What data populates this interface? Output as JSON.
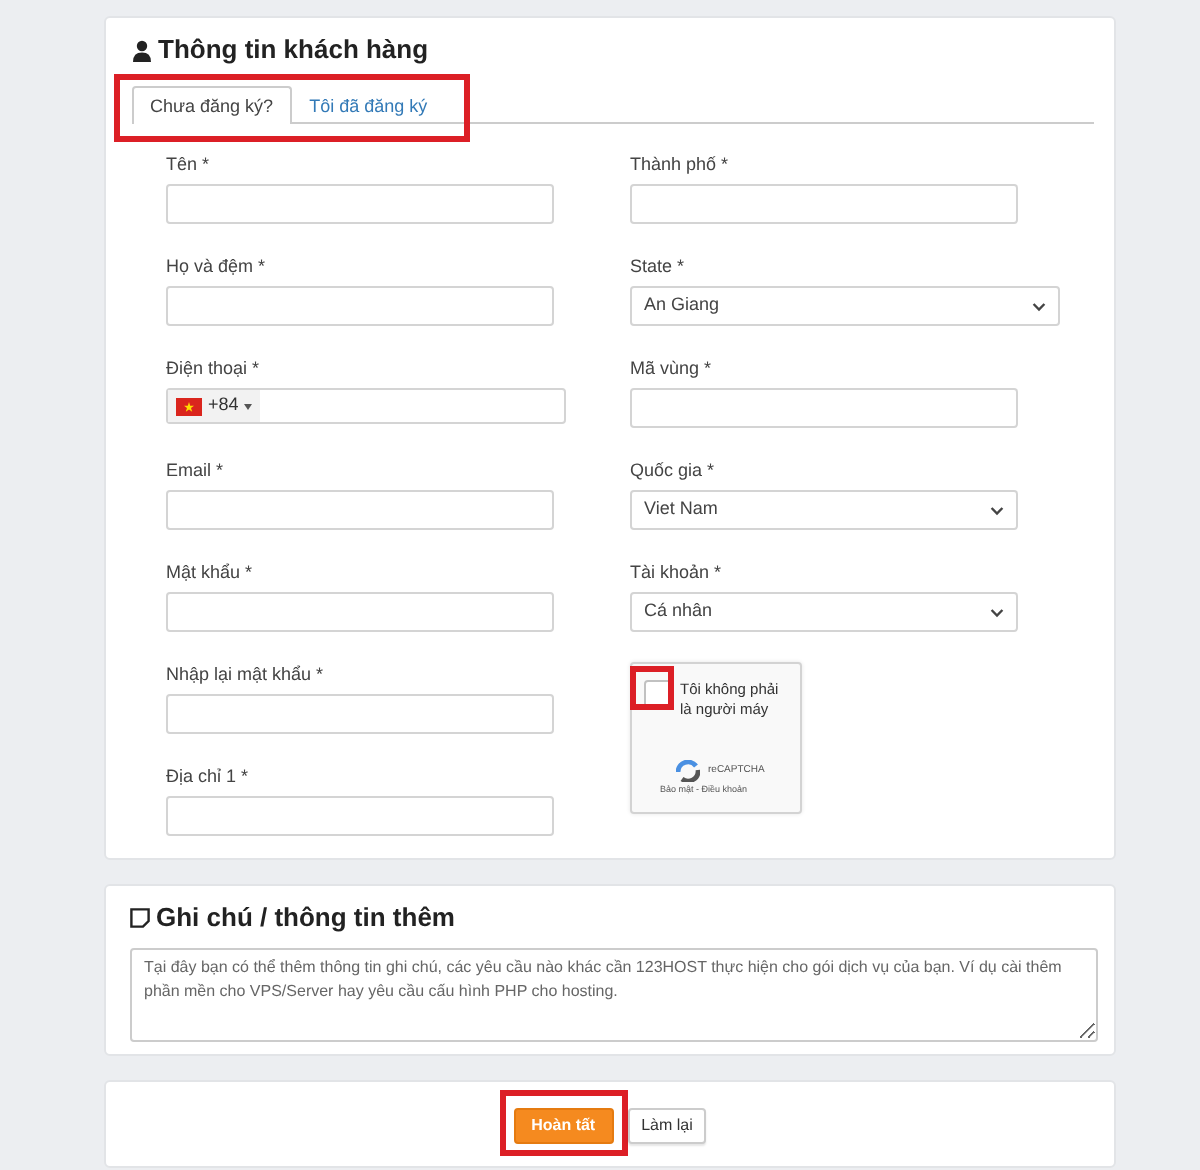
{
  "customer_info": {
    "title": "Thông tin khách hàng",
    "tabs": {
      "highlighted": true,
      "items": [
        {
          "label": "Chưa đăng ký?",
          "selected": true
        },
        {
          "label": "Tôi đã đăng ký",
          "selected": false
        }
      ]
    },
    "left_fields": [
      {
        "label": "Tên *",
        "kind": "text"
      },
      {
        "label": "Họ và đệm *",
        "kind": "text"
      },
      {
        "label": "Điện thoại *",
        "kind": "phone",
        "dial_code": "+84"
      },
      {
        "label": "Email *",
        "kind": "text"
      },
      {
        "label": "Mật khẩu *",
        "kind": "text"
      },
      {
        "label": "Nhập lại mật khẩu *",
        "kind": "text"
      },
      {
        "label": "Địa chỉ 1 *",
        "kind": "text"
      }
    ],
    "right_fields": [
      {
        "label": "Thành phố *",
        "kind": "text"
      },
      {
        "label": "State *",
        "kind": "select",
        "value": "An Giang",
        "wide": true
      },
      {
        "label": "Mã vùng *",
        "kind": "text"
      },
      {
        "label": "Quốc gia *",
        "kind": "select",
        "value": "Viet Nam",
        "wide": false
      },
      {
        "label": "Tài khoản *",
        "kind": "select",
        "value": "Cá nhân",
        "wide": false
      },
      {
        "kind": "captcha",
        "text": "Tôi không phải là người máy",
        "checked": false,
        "highlighted": true,
        "brand": "reCAPTCHA",
        "links": "Bảo mật - Điều khoản"
      }
    ]
  },
  "notes": {
    "title": "Ghi chú / thông tin thêm",
    "placeholder": "Tại đây bạn có thể thêm thông tin ghi chú, các yêu cầu nào khác cần 123HOST thực hiện cho gói dịch vụ của bạn. Ví dụ cài thêm phần mền cho VPS/Server hay yêu cầu cấu hình PHP cho hosting."
  },
  "buttons": [
    {
      "label": "Hoàn tất",
      "kind": "primary",
      "highlighted": true
    },
    {
      "label": "Làm lại",
      "kind": "secondary",
      "highlighted": false
    }
  ]
}
